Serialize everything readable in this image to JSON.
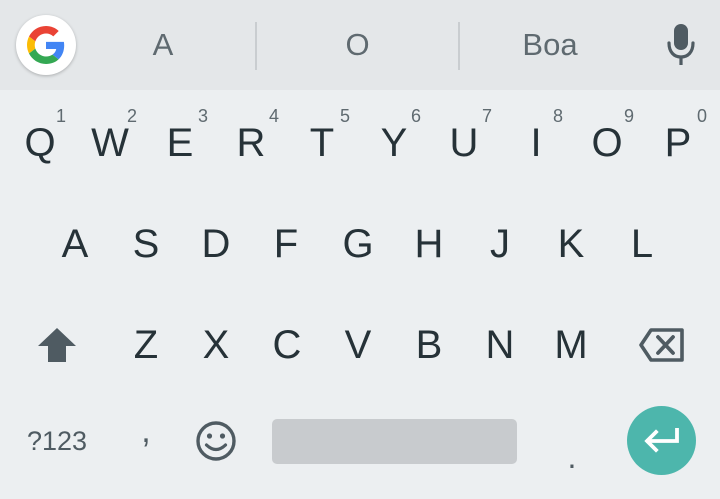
{
  "suggestions": [
    "A",
    "O",
    "Boa"
  ],
  "row1": [
    {
      "letter": "Q",
      "hint": "1"
    },
    {
      "letter": "W",
      "hint": "2"
    },
    {
      "letter": "E",
      "hint": "3"
    },
    {
      "letter": "R",
      "hint": "4"
    },
    {
      "letter": "T",
      "hint": "5"
    },
    {
      "letter": "Y",
      "hint": "6"
    },
    {
      "letter": "U",
      "hint": "7"
    },
    {
      "letter": "I",
      "hint": "8"
    },
    {
      "letter": "O",
      "hint": "9"
    },
    {
      "letter": "P",
      "hint": "0"
    }
  ],
  "row2": [
    "A",
    "S",
    "D",
    "F",
    "G",
    "H",
    "J",
    "K",
    "L"
  ],
  "row3": [
    "Z",
    "X",
    "C",
    "V",
    "B",
    "N",
    "M"
  ],
  "bottom": {
    "symbols_label": "?123",
    "comma_label": ",",
    "period_label": "."
  },
  "icons": {
    "google": "google-g-icon",
    "mic": "microphone-icon",
    "shift": "shift-arrow-icon",
    "backspace": "backspace-icon",
    "emoji": "emoji-smile-icon",
    "enter": "enter-return-icon"
  },
  "colors": {
    "background": "#eceff1",
    "strip": "#e4e7e9",
    "key_text": "#263238",
    "enter_accent": "#4db6ac",
    "spacebar": "#c8cbce"
  }
}
